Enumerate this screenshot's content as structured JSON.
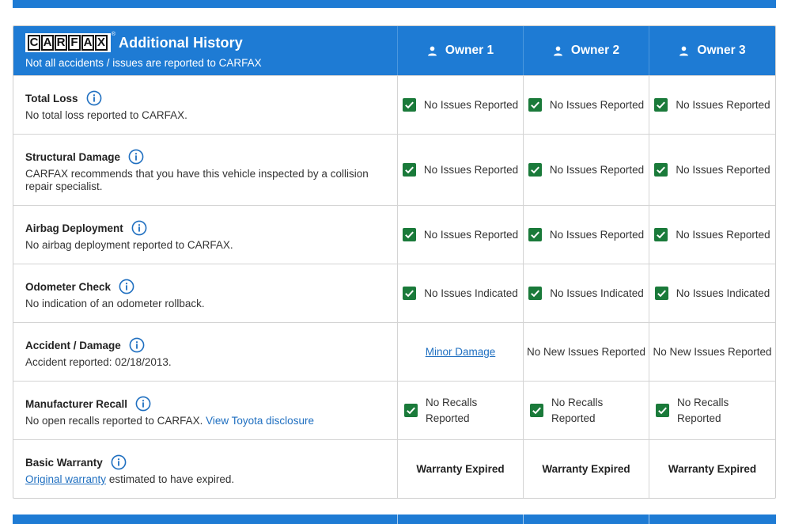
{
  "header": {
    "logo_letters": [
      "C",
      "A",
      "R",
      "F",
      "A",
      "X"
    ],
    "logo_trademark": "®",
    "title": "Additional History",
    "subtitle": "Not all accidents / issues are reported to CARFAX",
    "owners": [
      "Owner 1",
      "Owner 2",
      "Owner 3"
    ]
  },
  "rows": [
    {
      "title": "Total Loss",
      "description": "No total loss reported to CARFAX.",
      "statuses": [
        "No Issues Reported",
        "No Issues Reported",
        "No Issues Reported"
      ]
    },
    {
      "title": "Structural Damage",
      "description": "CARFAX recommends that you have this vehicle inspected by a collision repair specialist.",
      "statuses": [
        "No Issues Reported",
        "No Issues Reported",
        "No Issues Reported"
      ]
    },
    {
      "title": "Airbag Deployment",
      "description": "No airbag deployment reported to CARFAX.",
      "statuses": [
        "No Issues Reported",
        "No Issues Reported",
        "No Issues Reported"
      ]
    },
    {
      "title": "Odometer Check",
      "description": "No indication of an odometer rollback.",
      "statuses": [
        "No Issues Indicated",
        "No Issues Indicated",
        "No Issues Indicated"
      ]
    },
    {
      "title": "Accident / Damage",
      "description": "Accident reported: 02/18/2013.",
      "owner1_link": "Minor Damage",
      "statuses": [
        "No New Issues Reported",
        "No New Issues Reported"
      ]
    },
    {
      "title": "Manufacturer Recall",
      "description": "No open recalls reported to CARFAX.",
      "link": "View Toyota disclosure",
      "statuses": [
        "No Recalls Reported",
        "No Recalls Reported",
        "No Recalls Reported"
      ]
    },
    {
      "title": "Basic Warranty",
      "link": "Original warranty",
      "description": "estimated to have expired.",
      "statuses": [
        "Warranty Expired",
        "Warranty Expired",
        "Warranty Expired"
      ]
    }
  ],
  "colors": {
    "brand_blue": "#1e7bd4",
    "check_green": "#1a7a3a",
    "link_blue": "#1f6fc0"
  }
}
